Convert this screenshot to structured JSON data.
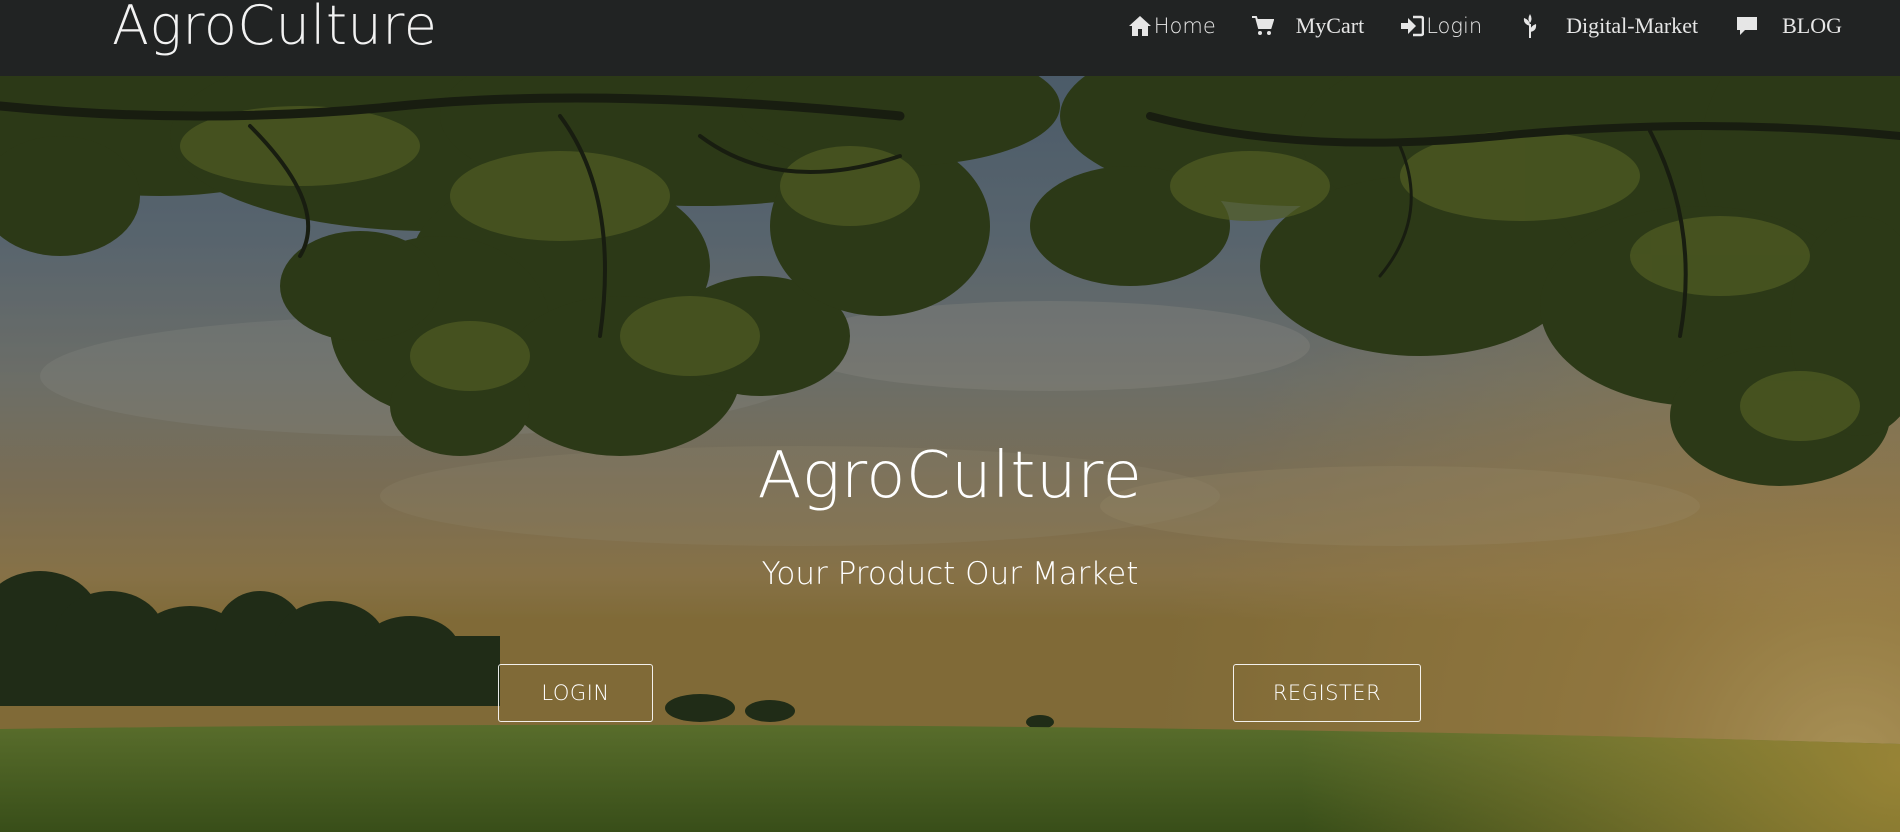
{
  "navbar": {
    "brand": "AgroCulture",
    "items": [
      {
        "label": "Home",
        "icon": "home-icon"
      },
      {
        "label": "MyCart",
        "icon": "shopping-cart-icon"
      },
      {
        "label": "Login",
        "icon": "login-icon"
      },
      {
        "label": "Digital-Market",
        "icon": "leaf-sprout-icon"
      },
      {
        "label": "BLOG",
        "icon": "comment-icon"
      }
    ]
  },
  "hero": {
    "title": "AgroCulture",
    "subtitle": "Your Product Our Market",
    "login_label": "LOGIN",
    "register_label": "REGISTER"
  },
  "colors": {
    "navbar_bg": "#212323",
    "text": "#ffffff",
    "grass": "#6d8a2e"
  }
}
